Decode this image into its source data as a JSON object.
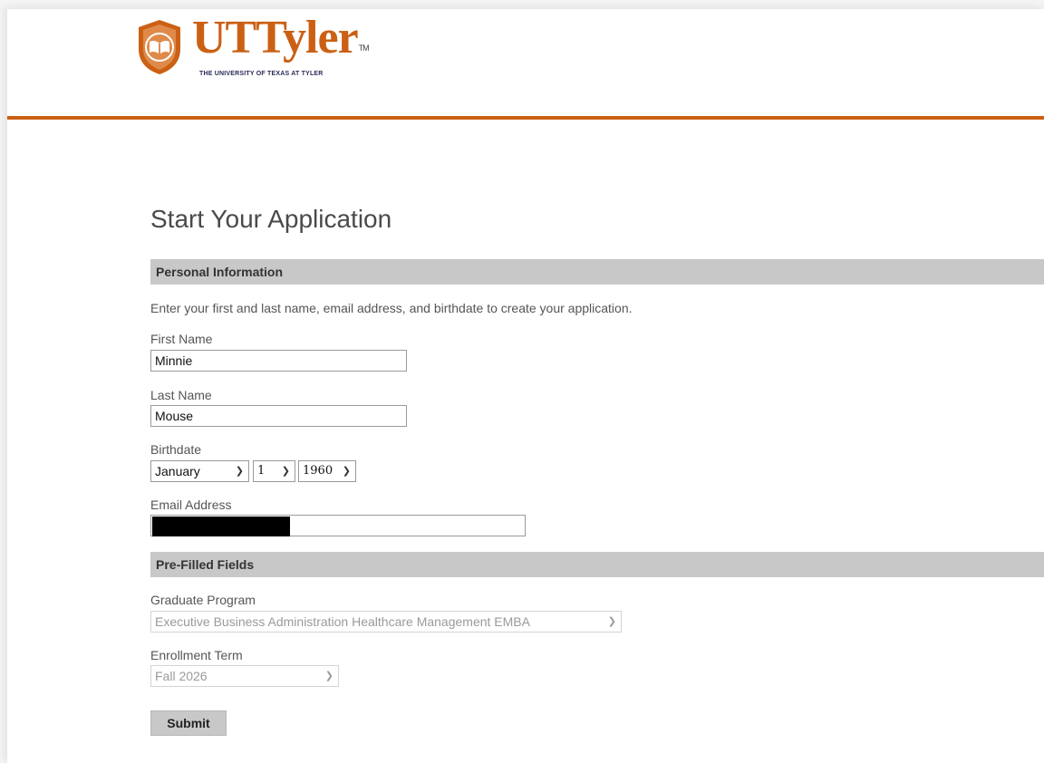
{
  "brand": {
    "wordmark": "UTTyler",
    "trademark": "TM",
    "tagline": "THE UNIVERSITY OF TEXAS AT TYLER",
    "accent_color": "#cb6015",
    "seal_icon": "book-laurel-shield-icon"
  },
  "page_title": "Start Your Application",
  "personal_section": {
    "heading": "Personal Information",
    "intro": "Enter your first and last name, email address, and birthdate to create your application.",
    "first_name": {
      "label": "First Name",
      "value": "Minnie"
    },
    "last_name": {
      "label": "Last Name",
      "value": "Mouse"
    },
    "birthdate": {
      "label": "Birthdate",
      "month": "January",
      "day": "1",
      "year": "1960"
    },
    "email": {
      "label": "Email Address",
      "value": "",
      "redacted": true
    }
  },
  "prefilled_section": {
    "heading": "Pre-Filled Fields",
    "graduate_program": {
      "label": "Graduate Program",
      "value": "Executive Business Administration Healthcare Management EMBA"
    },
    "enrollment_term": {
      "label": "Enrollment Term",
      "value": "Fall 2026"
    }
  },
  "submit_label": "Submit"
}
